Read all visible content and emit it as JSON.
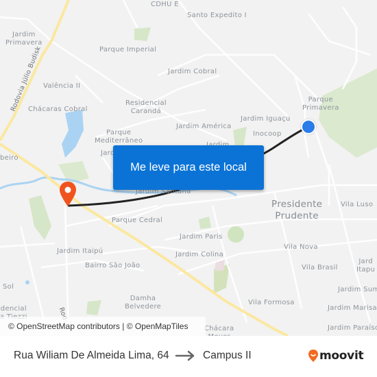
{
  "map": {
    "labels": [
      {
        "id": "cdhu-e",
        "text": "CDHU E"
      },
      {
        "id": "santo-expedito",
        "text": "Santo Expedito I"
      },
      {
        "id": "jardim-primavera",
        "text": "Jardim\nPrimavera"
      },
      {
        "id": "parque-imperial",
        "text": "Parque Imperial"
      },
      {
        "id": "jardim-cobral",
        "text": "Jardim Cobral"
      },
      {
        "id": "valencia-ii",
        "text": "Valência II"
      },
      {
        "id": "residencial-caranda",
        "text": "Residencial\nCarandá"
      },
      {
        "id": "chacaras-cobral",
        "text": "Chácaras Cobral"
      },
      {
        "id": "parque-primavera",
        "text": "Parque\nPrimavera"
      },
      {
        "id": "jardim-iguacu",
        "text": "Jardim Iguaçu"
      },
      {
        "id": "jardim-america",
        "text": "Jardim América"
      },
      {
        "id": "inocoop",
        "text": "Inocoop"
      },
      {
        "id": "parque-mediterraneo",
        "text": "Parque\nMediterrâneo"
      },
      {
        "id": "jardim-small",
        "text": "Jardim"
      },
      {
        "id": "jard-left",
        "text": "Jard"
      },
      {
        "id": "ribeiro",
        "text": "beiro"
      },
      {
        "id": "jardim-santana",
        "text": "Jardim Santana"
      },
      {
        "id": "presidente-prudente",
        "text": "Presidente\nPrudente"
      },
      {
        "id": "vila-luso",
        "text": "Vila Luso"
      },
      {
        "id": "parque-cedral",
        "text": "Parque Cedral"
      },
      {
        "id": "jardim-paris",
        "text": "Jardim Paris"
      },
      {
        "id": "vila-nova",
        "text": "Vila Nova"
      },
      {
        "id": "jardim-colina",
        "text": "Jardim Colina"
      },
      {
        "id": "jardim-itaipu",
        "text": "Jardim Itaipú"
      },
      {
        "id": "vila-brasil",
        "text": "Vila Brasil"
      },
      {
        "id": "jardim-itapura",
        "text": "Jard\nItapu"
      },
      {
        "id": "bairro-sao-joao",
        "text": "Bairro São João"
      },
      {
        "id": "sol",
        "text": "Sol"
      },
      {
        "id": "jardim-sumare",
        "text": "Jardim Sum"
      },
      {
        "id": "damha-belvedere",
        "text": "Damha\nBelvedere"
      },
      {
        "id": "vila-formosa",
        "text": "Vila Formosa"
      },
      {
        "id": "jardim-marisa",
        "text": "Jardim Marisa"
      },
      {
        "id": "residencial-tiezzi",
        "text": "dencial\na Tiezzi"
      },
      {
        "id": "chacara-meyer",
        "text": "Chácara\nMeyer"
      },
      {
        "id": "jardim-paraiso",
        "text": "Jardim Paraíso"
      }
    ],
    "road_labels": [
      {
        "id": "rodovia-julio-budisk",
        "text": "Rodovia Júlio Budisk"
      },
      {
        "id": "rodovia-bottom",
        "text": "Rod"
      }
    ],
    "cta_label": "Me leve para este local",
    "attribution": "© OpenStreetMap contributors | © OpenMapTiles",
    "colors": {
      "cta": "#0b73d6",
      "origin": "#2a7ce8",
      "destination": "#f0541e",
      "route": "#222222",
      "highway": "#fbe8a0",
      "water": "#aad3f3",
      "park": "#c8dfb4"
    }
  },
  "footer": {
    "from": "Rua Wiliam De Almeida Lima, 64",
    "arrow": "→",
    "to": "Campus II",
    "brand": "moovit",
    "brand_color": "#f26b21"
  }
}
